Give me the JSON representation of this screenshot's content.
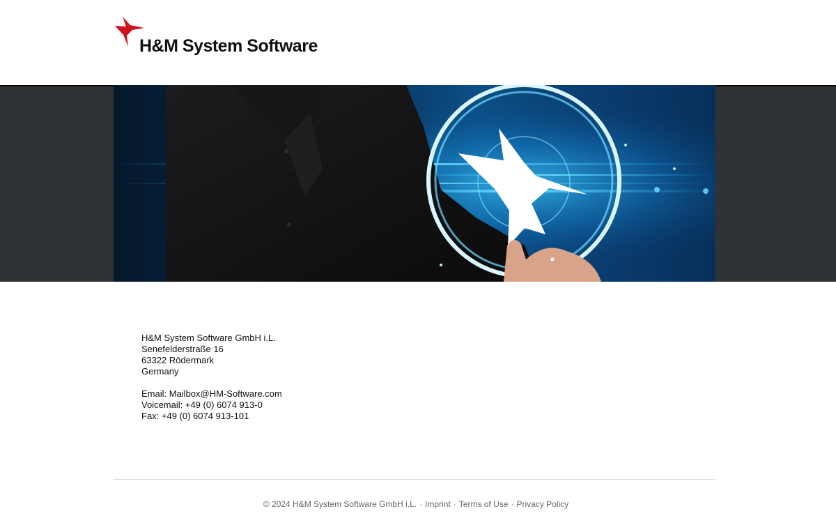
{
  "header": {
    "brand_name": "H&M System Software",
    "logo_icon": "red-hummingbird-icon",
    "brand_color": "#d0121b"
  },
  "hero": {
    "image": "hand-touching-glowing-hummingbird-circle",
    "accent_color": "#19b7ff"
  },
  "contact": {
    "company": "H&M System Software GmbH i.L.",
    "street": "Senefelderstraße 16",
    "city": "63322 Rödermark",
    "country": "Germany",
    "email": "Email: Mailbox@HM-Software.com",
    "voicemail": "Voicemail: +49 (0) 6074 913-0",
    "fax": "Fax: +49 (0) 6074 913-101"
  },
  "footer": {
    "copyright": "© 2024 H&M System Software GmbH i.L.",
    "separator": "·",
    "links": {
      "imprint": "Imprint",
      "terms": "Terms of Use",
      "privacy": "Privacy Policy"
    }
  }
}
